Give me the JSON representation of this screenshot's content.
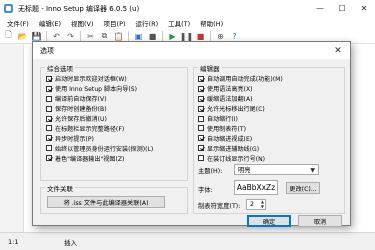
{
  "window": {
    "title": "无标题 - Inno Setup 编译器 6.0.5 (u)"
  },
  "menu": [
    "文件(F)",
    "编辑(E)",
    "视图(V)",
    "项目(P)",
    "运行(R)",
    "工具(T)",
    "帮助(H)"
  ],
  "status": {
    "position": "1:1",
    "mode": "插入"
  },
  "dialog": {
    "title": "选项",
    "general": {
      "title": "综合选项",
      "options": [
        {
          "label": "启动时显示欢迎对话框(W)",
          "checked": true
        },
        {
          "label": "使用 Inno Setup 脚本向导(S)",
          "checked": true
        },
        {
          "label": "编译前自动保存(V)",
          "checked": false
        },
        {
          "label": "保存时创建备份(B)",
          "checked": false
        },
        {
          "label": "允许保存后撤消(U)",
          "checked": true
        },
        {
          "label": "在标题栏显示完整路径(F)",
          "checked": false
        },
        {
          "label": "异步时提示(P)",
          "checked": true
        },
        {
          "label": "始终以管理员身份运行安装(探测)(L)",
          "checked": false
        },
        {
          "label": "着色\"编译器输出\"视图(Z)",
          "checked": true
        }
      ]
    },
    "file_assoc": {
      "title": "文件关联",
      "button": "将 .iss 文件与此编译器关联(A)"
    },
    "editor": {
      "title": "编辑器",
      "options": [
        {
          "label": "自动调用自动完成(功能)(M)",
          "checked": true
        },
        {
          "label": "使用语法高亮(X)",
          "checked": true
        },
        {
          "label": "缓缩语法加翻(A)",
          "checked": true
        },
        {
          "label": "允许光标移出行尾(C)",
          "checked": true
        },
        {
          "label": "自动缩行(I)",
          "checked": false
        },
        {
          "label": "使用制表符(T)",
          "checked": false
        },
        {
          "label": "自动缩进视成(E)",
          "checked": true
        },
        {
          "label": "显示缩进辅助线(G)",
          "checked": true
        },
        {
          "label": "在装订线显示行号(N)",
          "checked": false
        }
      ],
      "theme_label": "主题(H):",
      "theme_value": "明亮",
      "font_label": "字体:",
      "font_sample": "AaBbXxZz",
      "font_button": "更改(C)...",
      "tab_label": "制表符宽度(T):",
      "tab_value": "2"
    },
    "ok": "确定",
    "cancel": "取消"
  }
}
